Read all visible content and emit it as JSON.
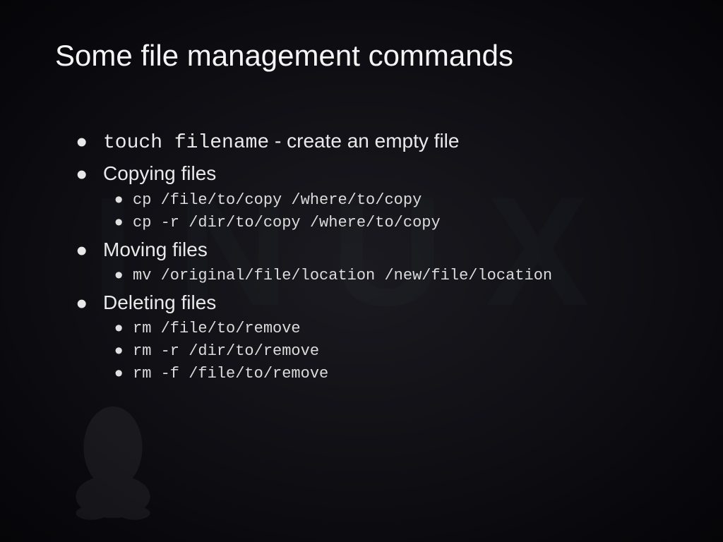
{
  "watermark": "INUX",
  "title": "Some file management commands",
  "item1": {
    "code": "touch filename",
    "desc": " - create an empty file"
  },
  "item2": {
    "label": "Copying files",
    "sub": [
      "cp /file/to/copy /where/to/copy",
      "cp -r /dir/to/copy /where/to/copy"
    ]
  },
  "item3": {
    "label": "Moving files",
    "sub": [
      "mv /original/file/location /new/file/location"
    ]
  },
  "item4": {
    "label": "Deleting files",
    "sub": [
      "rm /file/to/remove",
      "rm -r /dir/to/remove",
      "rm -f /file/to/remove"
    ]
  }
}
